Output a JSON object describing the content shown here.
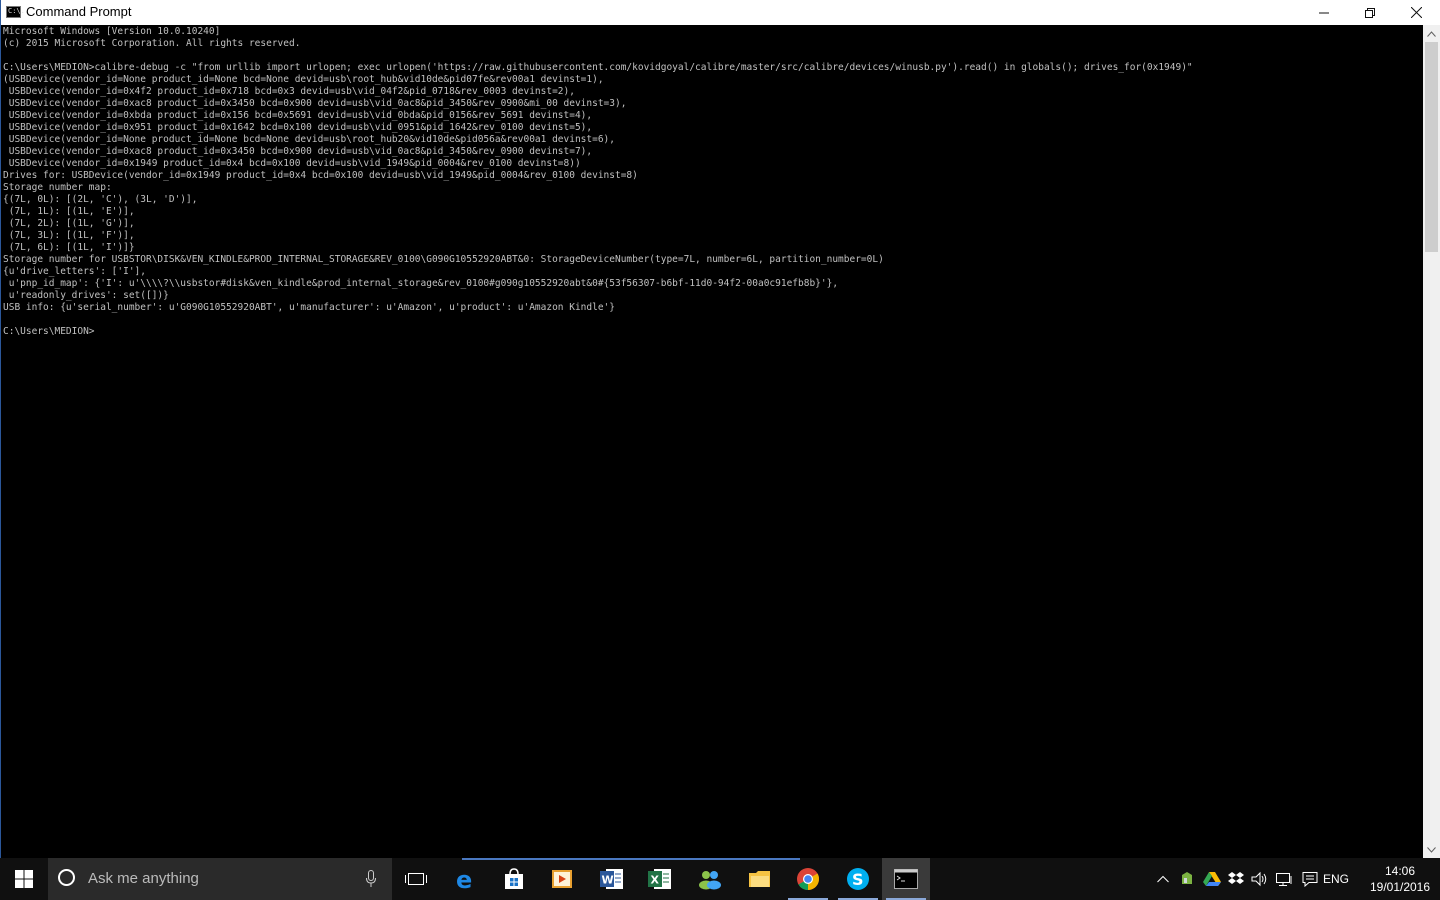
{
  "window": {
    "title": "Command Prompt",
    "icon_text": "C:\\."
  },
  "console": {
    "lines": [
      "Microsoft Windows [Version 10.0.10240]",
      "(c) 2015 Microsoft Corporation. All rights reserved.",
      "",
      "C:\\Users\\MEDION>calibre-debug -c \"from urllib import urlopen; exec urlopen('https://raw.githubusercontent.com/kovidgoyal/calibre/master/src/calibre/devices/winusb.py').read() in globals(); drives_for(0x1949)\"",
      "(USBDevice(vendor_id=None product_id=None bcd=None devid=usb\\root_hub&vid10de&pid07fe&rev00a1 devinst=1),",
      " USBDevice(vendor_id=0x4f2 product_id=0x718 bcd=0x3 devid=usb\\vid_04f2&pid_0718&rev_0003 devinst=2),",
      " USBDevice(vendor_id=0xac8 product_id=0x3450 bcd=0x900 devid=usb\\vid_0ac8&pid_3450&rev_0900&mi_00 devinst=3),",
      " USBDevice(vendor_id=0xbda product_id=0x156 bcd=0x5691 devid=usb\\vid_0bda&pid_0156&rev_5691 devinst=4),",
      " USBDevice(vendor_id=0x951 product_id=0x1642 bcd=0x100 devid=usb\\vid_0951&pid_1642&rev_0100 devinst=5),",
      " USBDevice(vendor_id=None product_id=None bcd=None devid=usb\\root_hub20&vid10de&pid056a&rev00a1 devinst=6),",
      " USBDevice(vendor_id=0xac8 product_id=0x3450 bcd=0x900 devid=usb\\vid_0ac8&pid_3450&rev_0900 devinst=7),",
      " USBDevice(vendor_id=0x1949 product_id=0x4 bcd=0x100 devid=usb\\vid_1949&pid_0004&rev_0100 devinst=8))",
      "Drives for: USBDevice(vendor_id=0x1949 product_id=0x4 bcd=0x100 devid=usb\\vid_1949&pid_0004&rev_0100 devinst=8)",
      "Storage number map:",
      "{(7L, 0L): [(2L, 'C'), (3L, 'D')],",
      " (7L, 1L): [(1L, 'E')],",
      " (7L, 2L): [(1L, 'G')],",
      " (7L, 3L): [(1L, 'F')],",
      " (7L, 6L): [(1L, 'I')]}",
      "Storage number for USBSTOR\\DISK&VEN_KINDLE&PROD_INTERNAL_STORAGE&REV_0100\\G090G10552920ABT&0: StorageDeviceNumber(type=7L, number=6L, partition_number=0L)",
      "{u'drive_letters': ['I'],",
      " u'pnp_id_map': {'I': u'\\\\\\\\?\\\\usbstor#disk&ven_kindle&prod_internal_storage&rev_0100#g090g10552920abt&0#{53f56307-b6bf-11d0-94f2-00a0c91efb8b}'},",
      " u'readonly_drives': set([])}",
      "USB info: {u'serial_number': u'G090G10552920ABT', u'manufacturer': u'Amazon', u'product': u'Amazon Kindle'}",
      "",
      "C:\\Users\\MEDION>"
    ]
  },
  "taskbar": {
    "search_placeholder": "Ask me anything",
    "apps": [
      {
        "name": "task-view"
      },
      {
        "name": "edge"
      },
      {
        "name": "store"
      },
      {
        "name": "media-player"
      },
      {
        "name": "word"
      },
      {
        "name": "excel"
      },
      {
        "name": "people"
      },
      {
        "name": "file-explorer"
      },
      {
        "name": "chrome"
      },
      {
        "name": "skype"
      },
      {
        "name": "command-prompt"
      }
    ],
    "language": "ENG",
    "time": "14:06",
    "date": "19/01/2016"
  },
  "colors": {
    "console_bg": "#000000",
    "console_fg": "#c0c0c0",
    "taskbar_bg": "#101010",
    "accent": "#2b579a"
  }
}
